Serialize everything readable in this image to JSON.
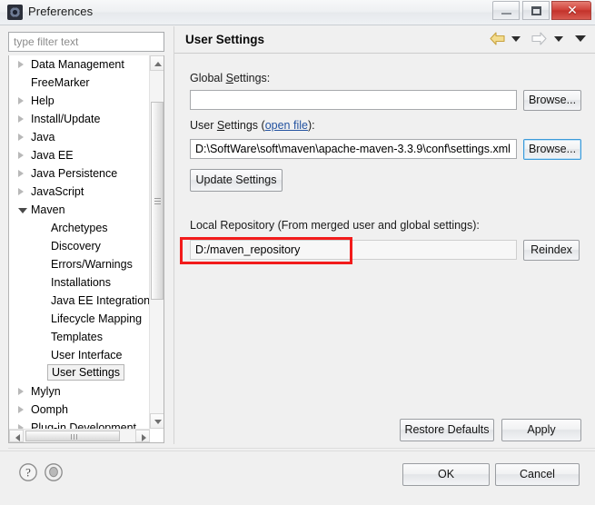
{
  "window": {
    "title": "Preferences",
    "icon": "preferences-gear-icon",
    "controls": {
      "minimize": "minimize-button",
      "maximize": "maximize-button",
      "close_glyph": "✕"
    }
  },
  "filter": {
    "placeholder": "type filter text",
    "value": ""
  },
  "tree": {
    "items": [
      {
        "label": "Data Management",
        "indent": 0,
        "state": "collapsed",
        "selected": false
      },
      {
        "label": "FreeMarker",
        "indent": 0,
        "state": "leaf",
        "selected": false
      },
      {
        "label": "Help",
        "indent": 0,
        "state": "collapsed",
        "selected": false
      },
      {
        "label": "Install/Update",
        "indent": 0,
        "state": "collapsed",
        "selected": false
      },
      {
        "label": "Java",
        "indent": 0,
        "state": "collapsed",
        "selected": false
      },
      {
        "label": "Java EE",
        "indent": 0,
        "state": "collapsed",
        "selected": false
      },
      {
        "label": "Java Persistence",
        "indent": 0,
        "state": "collapsed",
        "selected": false
      },
      {
        "label": "JavaScript",
        "indent": 0,
        "state": "collapsed",
        "selected": false
      },
      {
        "label": "Maven",
        "indent": 0,
        "state": "expanded",
        "selected": false
      },
      {
        "label": "Archetypes",
        "indent": 1,
        "state": "leaf",
        "selected": false
      },
      {
        "label": "Discovery",
        "indent": 1,
        "state": "leaf",
        "selected": false
      },
      {
        "label": "Errors/Warnings",
        "indent": 1,
        "state": "leaf",
        "selected": false
      },
      {
        "label": "Installations",
        "indent": 1,
        "state": "leaf",
        "selected": false
      },
      {
        "label": "Java EE Integration",
        "indent": 1,
        "state": "leaf",
        "selected": false
      },
      {
        "label": "Lifecycle Mapping",
        "indent": 1,
        "state": "leaf",
        "selected": false
      },
      {
        "label": "Templates",
        "indent": 1,
        "state": "leaf",
        "selected": false
      },
      {
        "label": "User Interface",
        "indent": 1,
        "state": "leaf",
        "selected": false
      },
      {
        "label": "User Settings",
        "indent": 1,
        "state": "leaf",
        "selected": true
      },
      {
        "label": "Mylyn",
        "indent": 0,
        "state": "collapsed",
        "selected": false
      },
      {
        "label": "Oomph",
        "indent": 0,
        "state": "collapsed",
        "selected": false
      },
      {
        "label": "Plug-in Development",
        "indent": 0,
        "state": "collapsed",
        "selected": false
      }
    ]
  },
  "panel": {
    "title": "User Settings",
    "nav": {
      "back": "back-arrow-icon",
      "back_menu": "back-dropdown-icon",
      "forward": "forward-arrow-icon",
      "forward_menu": "forward-dropdown-icon",
      "view_menu": "view-menu-icon"
    },
    "global_settings": {
      "label_pre": "Global ",
      "label_mnemonic": "S",
      "label_post": "ettings:",
      "value": "",
      "browse_label": "Browse..."
    },
    "user_settings": {
      "label_pre": "User ",
      "label_mnemonic": "S",
      "label_mid": "ettings (",
      "link": "open file",
      "label_post": "):",
      "value": "D:\\SoftWare\\soft\\maven\\apache-maven-3.3.9\\conf\\settings.xml",
      "browse_label": "Browse...",
      "update_label": "Update Settings"
    },
    "local_repository": {
      "label": "Local Repository (From merged user and global settings):",
      "value": "D:/maven_repository",
      "reindex_label": "Reindex",
      "highlight_color": "#f21b1b"
    },
    "restore_defaults_label": "Restore Defaults",
    "apply_label": "Apply"
  },
  "footer": {
    "help_icon": "help-question-icon",
    "pin_icon": "pin-circle-icon",
    "ok_label": "OK",
    "cancel_label": "Cancel"
  }
}
